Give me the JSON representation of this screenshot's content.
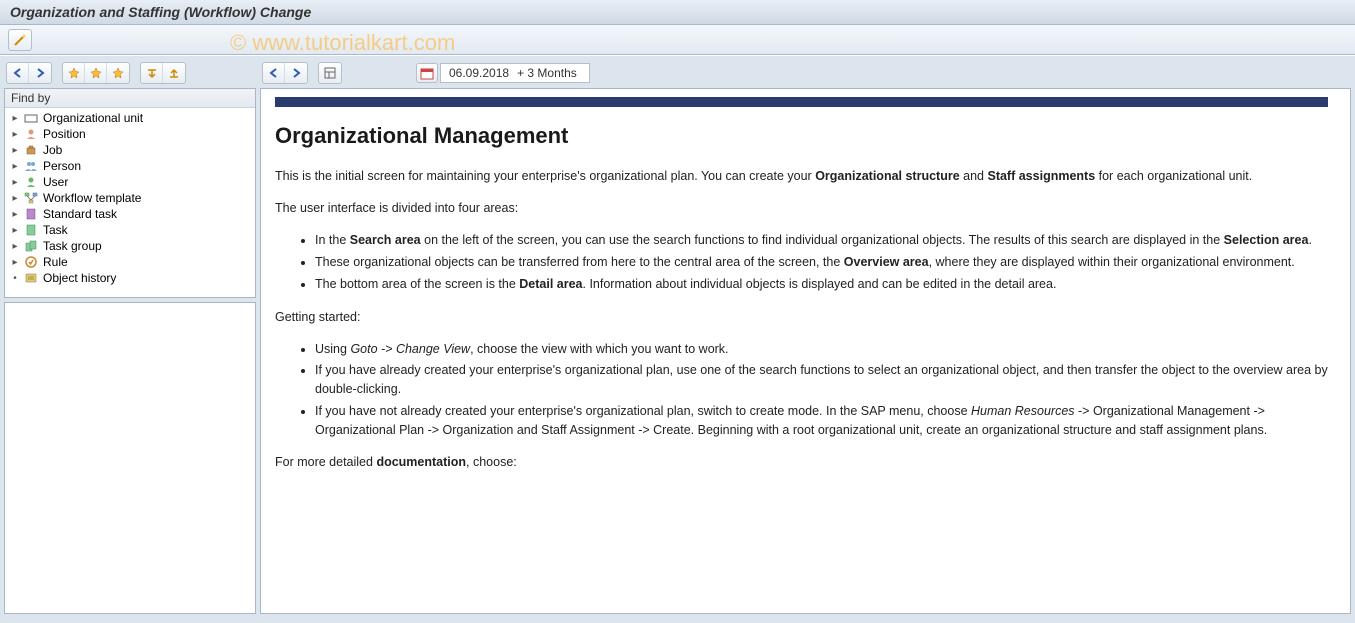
{
  "title": "Organization and Staffing (Workflow) Change",
  "watermark": "© www.tutorialkart.com",
  "left": {
    "find_by": "Find by",
    "items": [
      {
        "label": "Organizational unit",
        "icon": "org-unit-icon"
      },
      {
        "label": "Position",
        "icon": "position-icon"
      },
      {
        "label": "Job",
        "icon": "job-icon"
      },
      {
        "label": "Person",
        "icon": "person-icon"
      },
      {
        "label": "User",
        "icon": "user-icon"
      },
      {
        "label": "Workflow template",
        "icon": "workflow-icon"
      },
      {
        "label": "Standard task",
        "icon": "std-task-icon"
      },
      {
        "label": "Task",
        "icon": "task-icon"
      },
      {
        "label": "Task group",
        "icon": "task-group-icon"
      },
      {
        "label": "Rule",
        "icon": "rule-icon"
      },
      {
        "label": "Object history",
        "icon": "history-icon"
      }
    ]
  },
  "right": {
    "date": "06.09.2018",
    "duration": "+ 3 Months",
    "heading": "Organizational Management",
    "intro_a": "This is the initial screen for maintaining your enterprise's organizational plan. You can create your ",
    "intro_b": "Organizational structure",
    "intro_c": " and ",
    "intro_d": "Staff assignments",
    "intro_e": " for each organizational unit.",
    "areas_intro": "The user interface is divided into four areas:",
    "area1_a": "In the ",
    "area1_b": "Search area",
    "area1_c": " on the left of the screen, you can use the search functions to find individual organizational objects. The results of this search are displayed in the ",
    "area1_d": "Selection area",
    "area1_e": ".",
    "area2_a": "These organizational objects can be transferred from here to the central area of the screen, the ",
    "area2_b": "Overview area",
    "area2_c": ", where they are displayed within their organizational environment.",
    "area3_a": "The bottom area of the screen is the ",
    "area3_b": "Detail area",
    "area3_c": ". Information about individual objects is displayed and can be edited in the detail area.",
    "getting_started": "Getting started:",
    "gs1_a": "Using ",
    "gs1_b": "Goto -> Change View",
    "gs1_c": ", choose the view with which you want to work.",
    "gs2": "If you have already created your enterprise's organizational plan, use one of the search functions to select an organizational object, and then transfer the object to the overview area by double-clicking.",
    "gs3_a": "If you have not already created your enterprise's organizational plan, switch to create mode. In the SAP menu, choose ",
    "gs3_b": "Human Resources",
    "gs3_c": " -> Organizational Management -> Organizational Plan -> Organization and Staff Assignment -> Create. Beginning with a root organizational unit, create an organizational structure and staff assignment plans.",
    "doc_a": "For more detailed ",
    "doc_b": "documentation",
    "doc_c": ", choose:"
  }
}
